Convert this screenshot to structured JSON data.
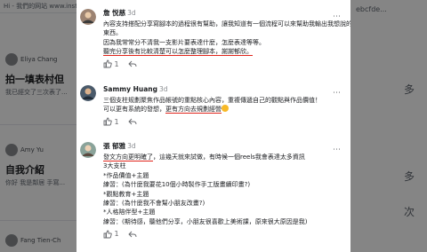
{
  "background": {
    "top_snippet": "Hi - 我們的网站 www.insta",
    "right_top": "ebcfde...",
    "posts": [
      {
        "name": "Eliya Chang",
        "title": "拍一填表村但",
        "sub": "我已經交了三次表了..."
      },
      {
        "name": "Amy Yu",
        "title": "自我介紹",
        "sub": "你好 我是鄰居 手寫..."
      },
      {
        "name": "Fang Tien-Ch",
        "title": "",
        "sub": ""
      }
    ],
    "right_texts": [
      "多",
      "多",
      "次"
    ]
  },
  "comments": [
    {
      "author": "詹 悦慈",
      "time": "3d",
      "lines": [
        "內容支持搭配分享寫腳本的過程很有幫助，讓我知道有一個流程可以來幫助我輸出我想說的",
        "東西。",
        "因為我常常分不清我一支影片要表達什麼，怎麼表達等等。",
        "聽完分享後有比較清楚可以怎麼整理腳本，謝謝郁欣。"
      ],
      "underline_line": 3,
      "reaction_count": "1",
      "reply_label": "↩"
    },
    {
      "author": "Sammy Huang",
      "time": "3d",
      "lines": [
        "三個支柱规劃聚焦作品帳號的重點核心內容，重複傳遞自己的觀點與作品價值！",
        "可以更有系統的發想，更有方向去規劃經營"
      ],
      "inline_underline": "更有方向去規劃經營",
      "reaction_count": "1",
      "reply_label": "↩"
    },
    {
      "author": "張 郁雅",
      "time": "3d",
      "lines": [
        "發文方向更明確了，這幾天就來試做，有時候一個reels我會表達太多資訊",
        "3大支柱",
        "*作品價值+主題",
        "練習：(為什麼我要花10個小時製作手工版畫續印畫?)",
        "*觀點教育+主題",
        "練習：(為什麼我不會幫小朋友改畫?)",
        "*人格陪伴型+主題",
        "練習：(期待感，聽他們分享，小朋友很喜歡上美術課，原來很大原因是我)"
      ],
      "inline_underline": "發文方向更明確了",
      "reaction_count": "1",
      "reply_label": "↩"
    }
  ],
  "colors": {
    "underline": "#e0241b",
    "text": "#1c1e21",
    "muted": "#65676b"
  },
  "icons": [
    "like-icon",
    "reply-icon",
    "more-icon"
  ]
}
